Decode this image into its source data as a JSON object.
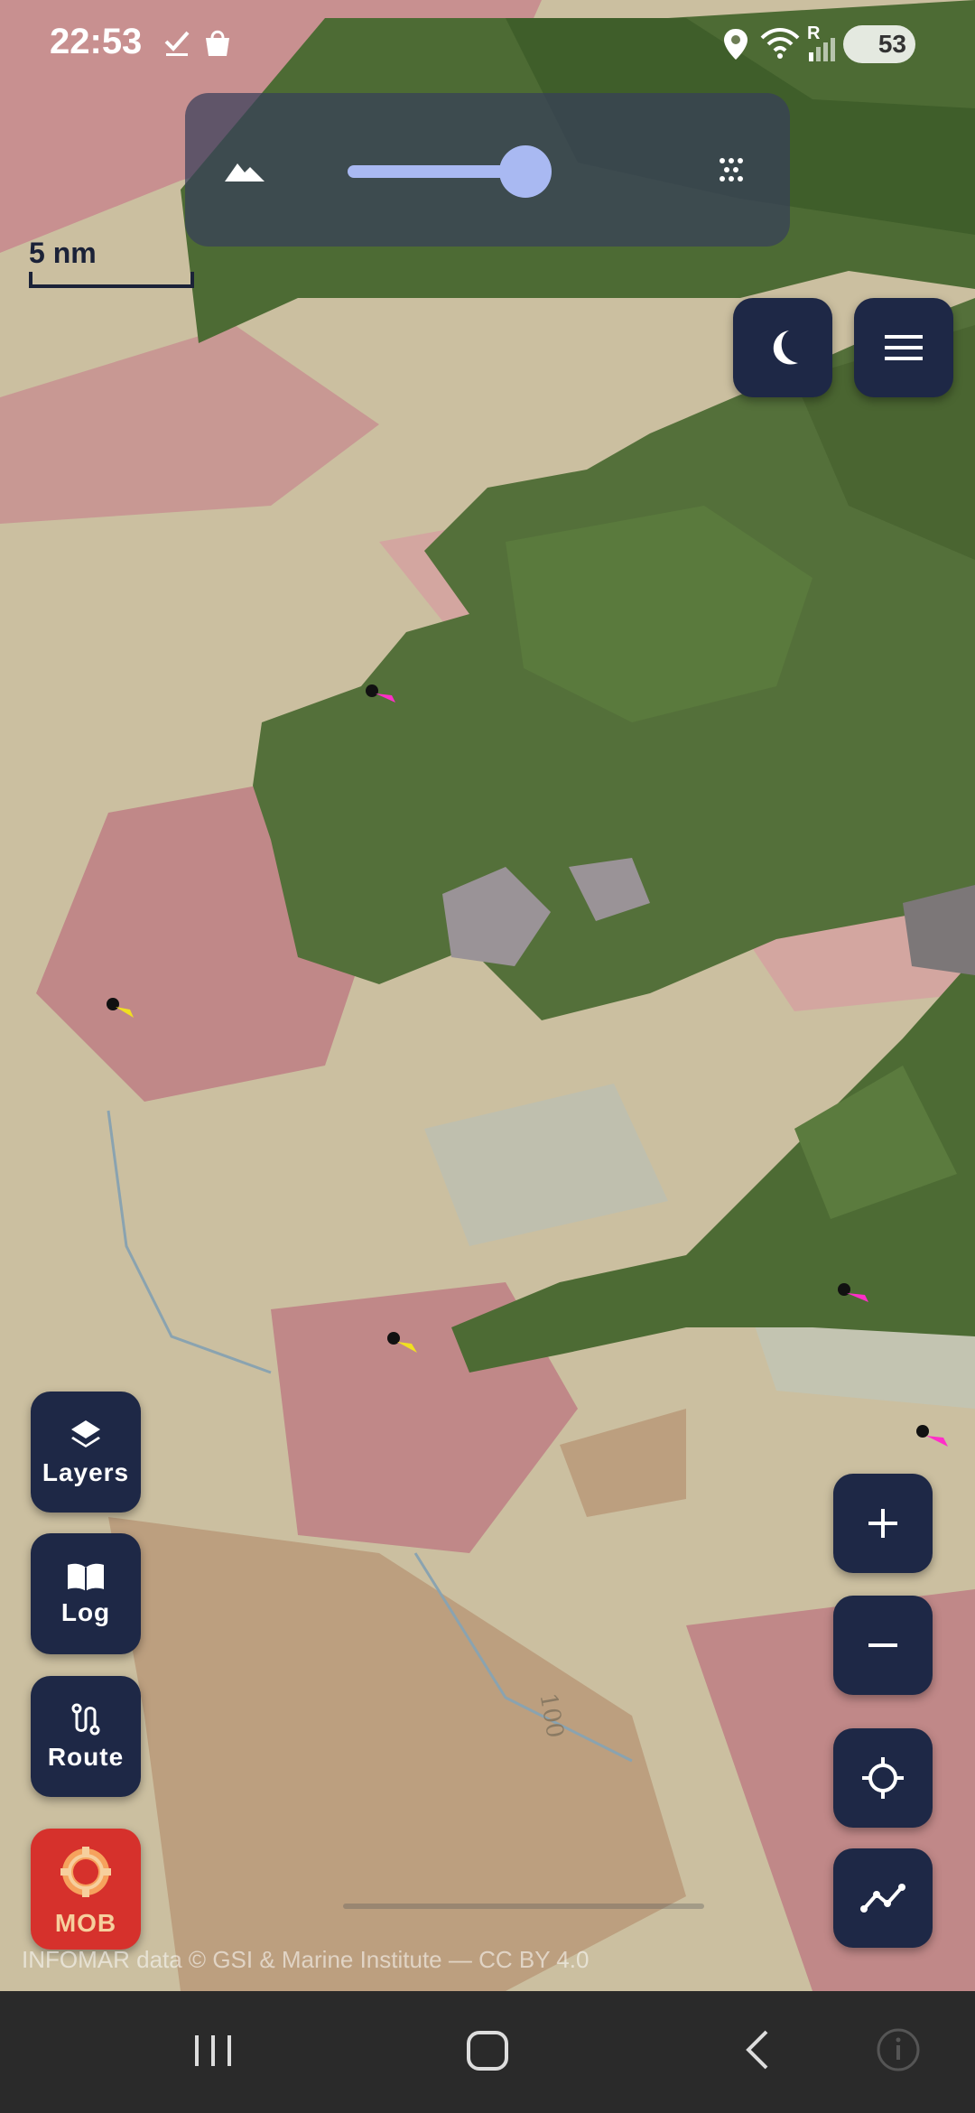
{
  "status_bar": {
    "time": "22:53",
    "battery": "53",
    "roaming_indicator": "R",
    "icons": [
      "check-icon",
      "shopping-bag-icon",
      "location-pin-icon",
      "wifi-icon",
      "signal-icon",
      "battery-icon"
    ]
  },
  "map_overlay": {
    "icons": [
      "terrain-icon",
      "dots-pattern-icon"
    ],
    "slider_level_percent": 70
  },
  "scale": {
    "label": "5 nm"
  },
  "top_buttons": [
    "night-mode-icon",
    "menu-icon"
  ],
  "left_buttons": {
    "layers": "Layers",
    "log": "Log",
    "route": "Route",
    "mob": "MOB"
  },
  "right_buttons": [
    "zoom-in-icon",
    "zoom-out-icon",
    "locate-icon",
    "track-icon"
  ],
  "map": {
    "depth_label": "100"
  },
  "attribution": "INFOMAR data © GSI & Marine Institute — CC BY 4.0",
  "nav_bar": [
    "recent-apps-icon",
    "home-icon",
    "back-icon",
    "info-icon"
  ],
  "colors": {
    "button_bg": "#1e2846",
    "mob_bg": "#d6312c",
    "slider": "#a9b9f2",
    "land": "#4b6a35",
    "seabed_sand": "#cbbfa0",
    "seabed_rock": "#c89090"
  }
}
